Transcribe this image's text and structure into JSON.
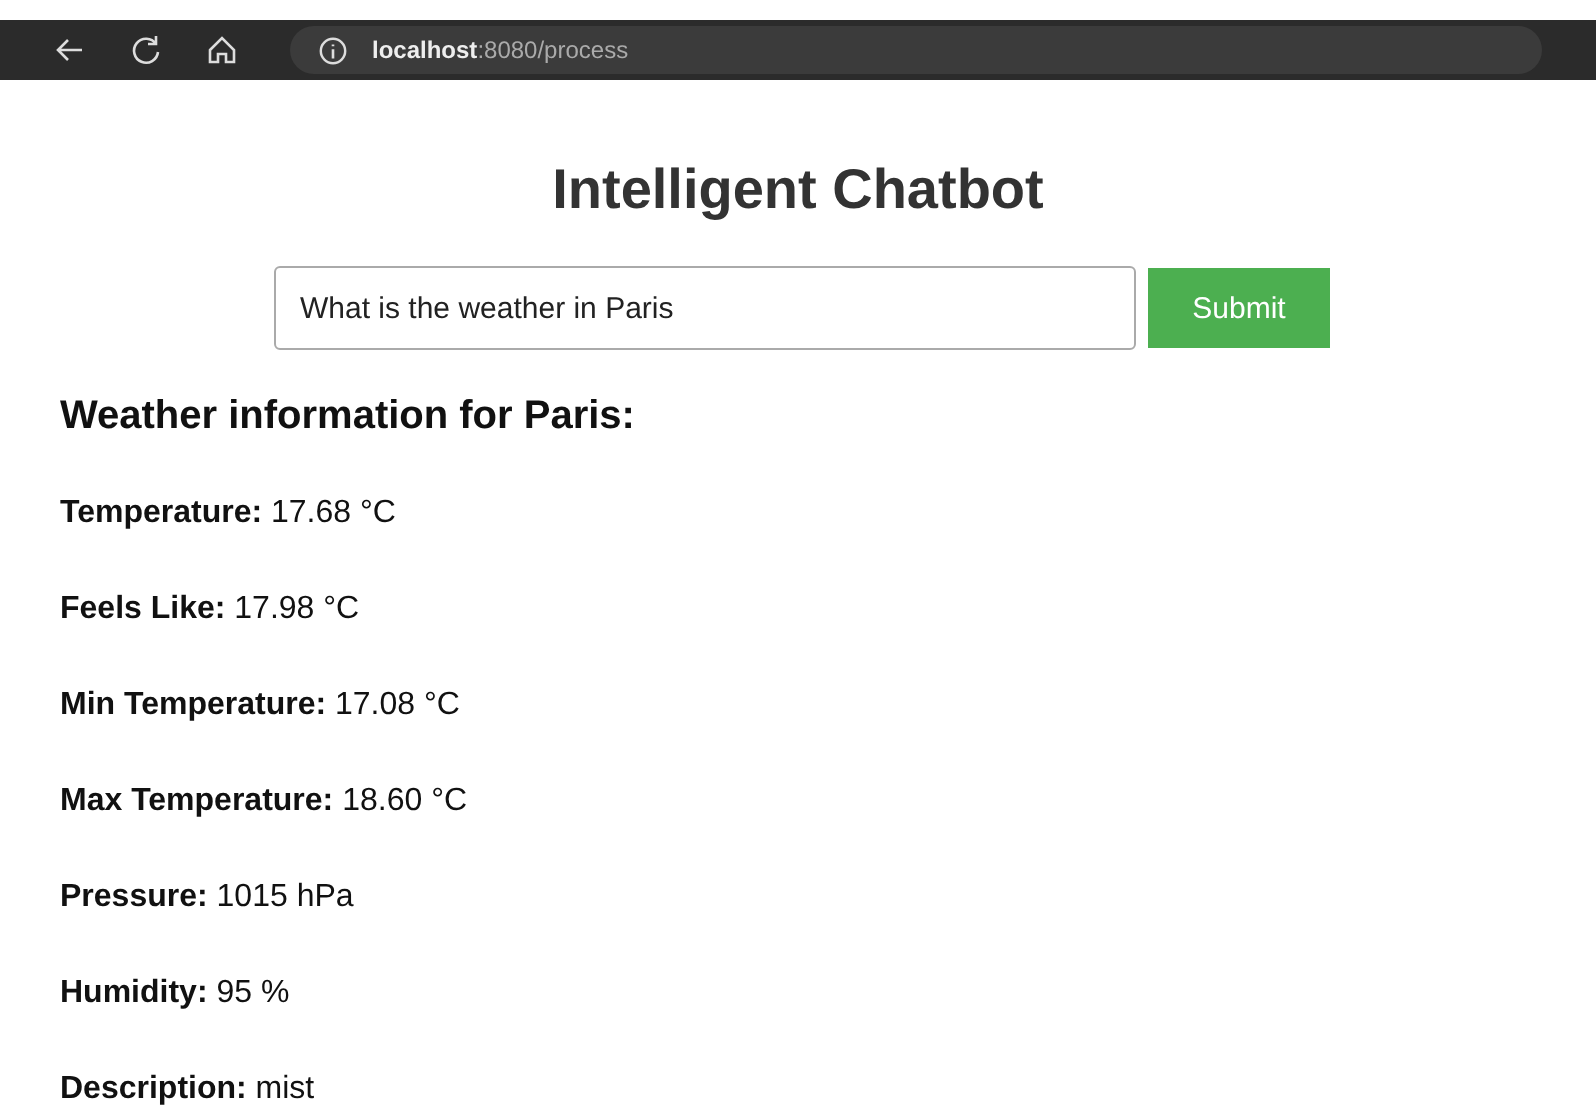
{
  "browser": {
    "url_host": "localhost",
    "url_rest": ":8080/process"
  },
  "title": "Intelligent Chatbot",
  "query": {
    "value": "What is the weather in Paris"
  },
  "submit": "Submit",
  "heading": "Weather information for Paris:",
  "fields": [
    {
      "label": "Temperature:",
      "value": "17.68 °C"
    },
    {
      "label": "Feels Like:",
      "value": "17.98 °C"
    },
    {
      "label": "Min Temperature:",
      "value": "17.08 °C"
    },
    {
      "label": "Max Temperature:",
      "value": "18.60 °C"
    },
    {
      "label": "Pressure:",
      "value": "1015 hPa"
    },
    {
      "label": "Humidity:",
      "value": "95 %"
    },
    {
      "label": "Description:",
      "value": "mist"
    }
  ]
}
